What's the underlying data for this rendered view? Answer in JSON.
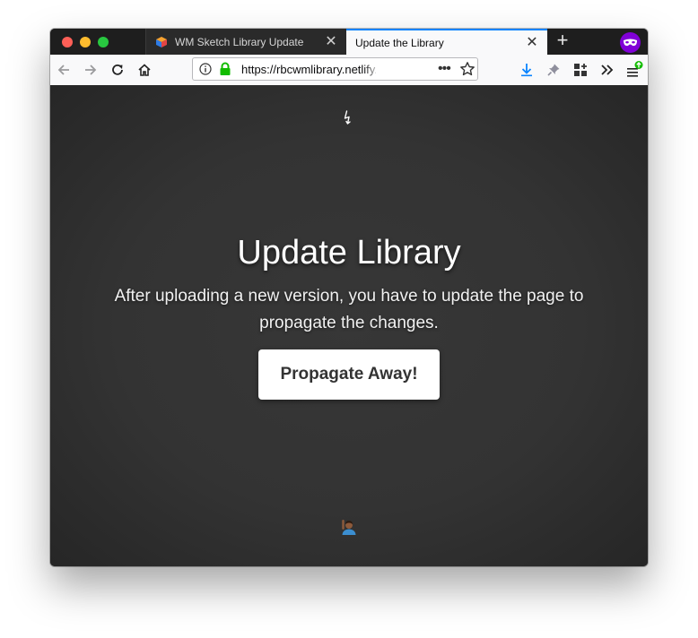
{
  "browser": {
    "tabs": [
      {
        "title": "WM Sketch Library Update",
        "active": false
      },
      {
        "title": "Update the Library",
        "active": true
      }
    ],
    "url": "https://rbcwmlibrary.netlify.co",
    "accent_color": "#0a84ff",
    "profile_color": "#8000d7"
  },
  "page": {
    "title": "Update Library",
    "description": "After uploading a new version, you have to update the page to propagate the changes.",
    "button_label": "Propagate Away!",
    "top_icon": "lightning-bolt-icon",
    "bottom_icon": "person-raising-hand-emoji"
  }
}
